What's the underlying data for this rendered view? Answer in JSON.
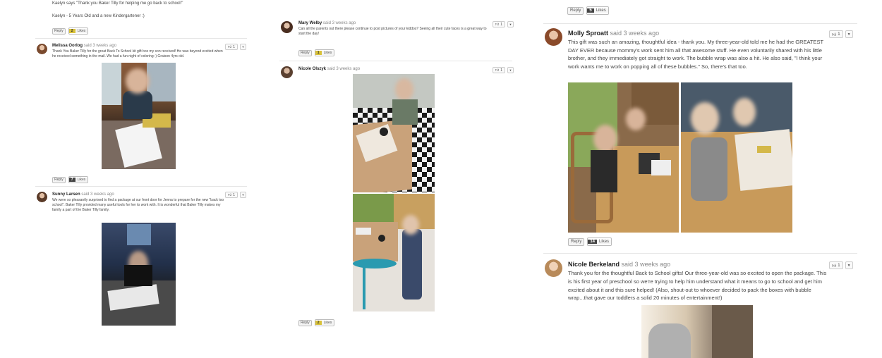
{
  "col1": {
    "top_post": {
      "quote": "Kaelyn says \"Thank you Baker Tilly for helping me go back to school!\"",
      "caption": "Kaelyn - 5 Years Old and a new Kindergartener :)",
      "reply": "Reply",
      "likes_count": "2",
      "likes_label": "Likes"
    },
    "post1": {
      "author": "Melissa Oorlog",
      "meta": "said 3 weeks ago",
      "text": "Thank You Baker Tilly for the great Back To School kit gift box my son received! He was beyond excited when he received something in the mail. We had a fun night of coloring :) Graison 4yrs old.",
      "vote_count": "1",
      "reply": "Reply",
      "likes_count": "7",
      "likes_label": "Likes"
    },
    "post2": {
      "author": "Sunny Larsen",
      "meta": "said 3 weeks ago",
      "text": "We were so pleasantly surprised to find a package at our front door for Jenna to prepare for the new \"back too school\". Baker Tilly provided many useful tools for her to work with. It is wonderful that Baker Tilly makes my family a part of the Baker Tilly family.",
      "vote_count": "1"
    }
  },
  "col2": {
    "post1": {
      "author": "Mary Welby",
      "meta": "said 3 weeks ago",
      "text": "Can all the parents out there please continue to post pictures of your kiddos? Seeing all their cute faces is a great way to start the day!",
      "vote_count": "1",
      "reply": "Reply",
      "likes_count": "1",
      "likes_label": "Likes"
    },
    "post2": {
      "author": "Nicole Olszyk",
      "meta": "said 3 weeks ago",
      "vote_count": "1",
      "reply": "Reply",
      "likes_count": "2",
      "likes_label": "Likes"
    }
  },
  "col3": {
    "top_actions": {
      "reply": "Reply",
      "likes_count": "5",
      "likes_label": "Likes"
    },
    "post1": {
      "author": "Molly Sproatt",
      "meta": "said 3 weeks ago",
      "text": "This gift was such an amazing, thoughtful idea - thank you. My three-year-old told me he had the GREATEST DAY EVER because mommy's work sent him all that awesome stuff. He even voluntarily shared with his little brother, and they immediately got straight to work. The bubble wrap was also a hit. He also said, \"I think your work wants me to work on popping all of these bubbles.\" So, there's that too.",
      "vote_count": "1",
      "reply": "Reply",
      "likes_count": "14",
      "likes_label": "Likes"
    },
    "post2": {
      "author": "Nicole Berkeland",
      "meta": "said 3 weeks ago",
      "text": "Thank you for the thoughtful Back to School gifts! Our three-year-old was so excited to open the package. This is his first year of preschool so we're trying to help him understand what it means to go to school and get him excited about it and this sure helped! (Also, shout-out to whoever decided to pack the boxes with bubble wrap...that gave our toddlers a solid 20 minutes of entertainment!)",
      "vote_count": "1"
    }
  },
  "colors": {
    "likes_dark": "#444444",
    "likes_gold": "#d9c23a"
  },
  "icons": {
    "vote": "thumbs-up-icon",
    "menu": "chevron-down-icon"
  }
}
